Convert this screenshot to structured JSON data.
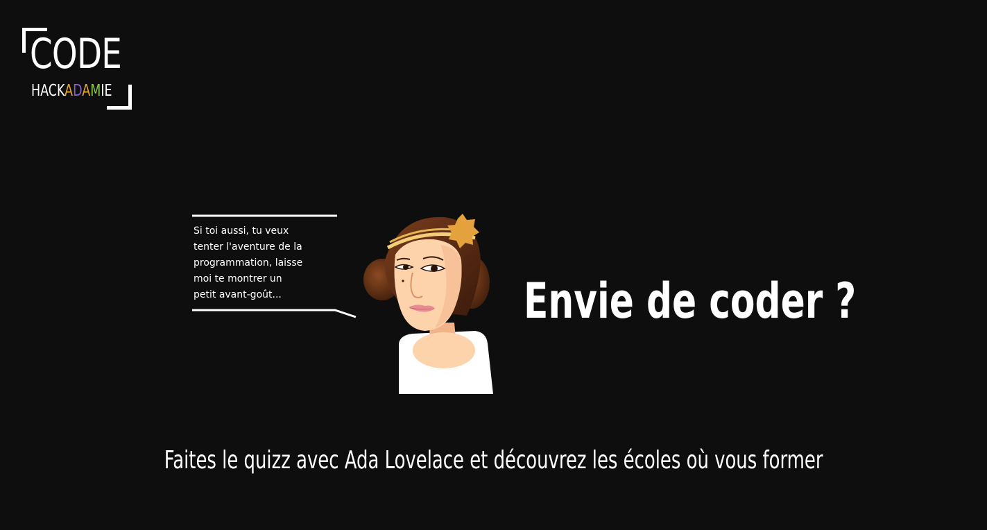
{
  "logo": {
    "word_top": "CODE",
    "word_bottom": [
      {
        "text": "HACK",
        "color": "#ffffff"
      },
      {
        "text": "A",
        "color": "#e8a82b"
      },
      {
        "text": "D",
        "color": "#8a5fc2"
      },
      {
        "text": "A",
        "color": "#e8a82b"
      },
      {
        "text": "M",
        "color": "#8cc84b"
      },
      {
        "text": "IE",
        "color": "#ffffff"
      }
    ]
  },
  "bubble": {
    "text": "Si toi aussi, tu veux\ntenter l'aventure de la\nprogrammation, laisse\nmoi te montrer un\npetit avant-goût..."
  },
  "character": {
    "icon": "ada-lovelace-illustration"
  },
  "hero": {
    "headline": "Envie de coder ?",
    "subtitle": "Faites le quizz avec Ada Lovelace et découvrez les écoles où vous former"
  },
  "colors": {
    "background": "#0e0e0f",
    "text": "#ffffff",
    "accent_gold": "#e3a23c"
  }
}
